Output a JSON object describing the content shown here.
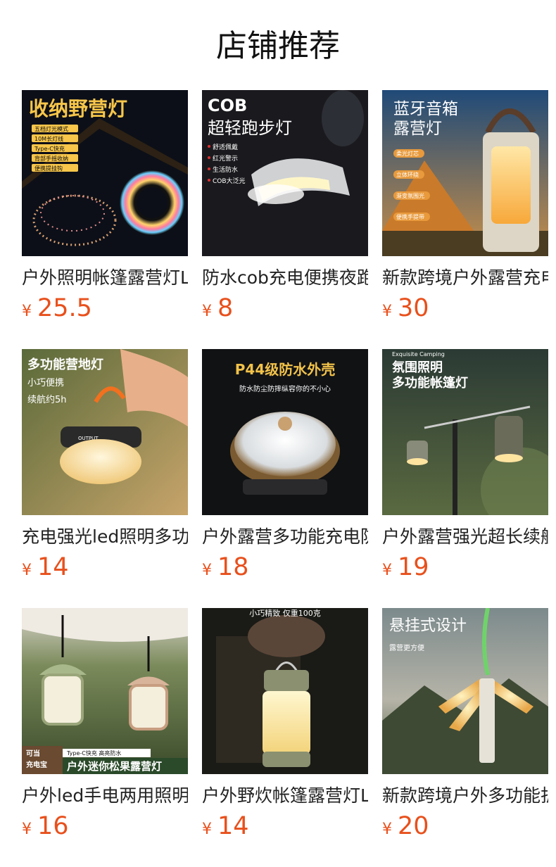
{
  "page": {
    "title": "店铺推荐"
  },
  "products": [
    {
      "name": "户外照明帐篷露营灯LED",
      "currency": "¥",
      "price": "25.5",
      "thumb": {
        "headline": "收纳野营灯",
        "tags": [
          "五档灯光模式",
          "10M长灯线",
          "Type-C快充",
          "背部手摇收纳",
          "便携提挂钩"
        ]
      }
    },
    {
      "name": "防水cob充电便携夜跑灯",
      "currency": "¥",
      "price": "8",
      "thumb": {
        "headline_1": "COB",
        "headline_2": "超轻跑步灯",
        "tags": [
          "舒适佩戴",
          "红光警示",
          "生活防水",
          "COB大泛光"
        ]
      }
    },
    {
      "name": "新款跨境户外露营充电灯",
      "currency": "¥",
      "price": "30",
      "thumb": {
        "headline_1": "蓝牙音箱",
        "headline_2": "露营灯",
        "tags": [
          "柔光灯芯",
          "立体环绕",
          "渐变氛围光",
          "便携手提带"
        ]
      }
    },
    {
      "name": "充电强光led照明多功能灯",
      "currency": "¥",
      "price": "14",
      "thumb": {
        "headline": "多功能营地灯",
        "line_1": "小巧便携",
        "line_2": "续航约5h"
      }
    },
    {
      "name": "户外露营多功能充电防水灯",
      "currency": "¥",
      "price": "18",
      "thumb": {
        "headline": "P44级防水外壳",
        "subline": "防水防尘防摔纵容你的不小心"
      }
    },
    {
      "name": "户外露营强光超长续航灯",
      "currency": "¥",
      "price": "19",
      "thumb": {
        "small": "Exquisite Camping",
        "headline_1": "氛围照明",
        "headline_2": "多功能帐篷灯"
      }
    },
    {
      "name": "户外led手电两用照明灯",
      "currency": "¥",
      "price": "16",
      "thumb": {
        "badge_1": "可当",
        "badge_2": "充电宝",
        "tag": "Type-C快充  高亮防水",
        "banner": "户外迷你松果露营灯"
      }
    },
    {
      "name": "户外野炊帐篷露营灯LED",
      "currency": "¥",
      "price": "14",
      "thumb": {
        "headline": "小巧精致 仅重100克"
      }
    },
    {
      "name": "新款跨境户外多功能折叠灯",
      "currency": "¥",
      "price": "20",
      "thumb": {
        "headline": "悬挂式设计",
        "subline": "露营更方便"
      }
    }
  ],
  "colors": {
    "price": "#e8501c",
    "title": "#111111",
    "name": "#222222"
  }
}
